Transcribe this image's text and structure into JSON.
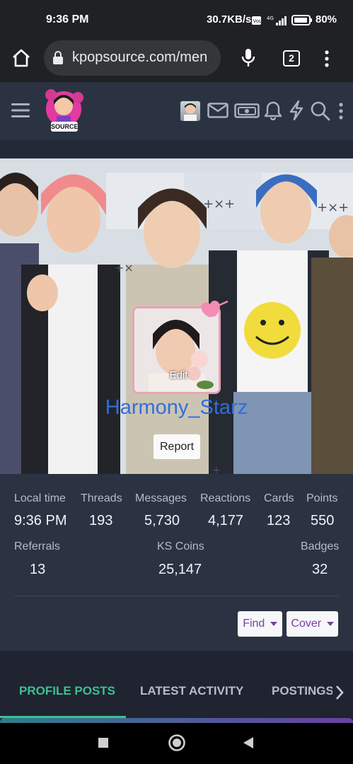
{
  "status_bar": {
    "time": "9:36 PM",
    "network_speed": "30.7KB/s",
    "battery": "80%"
  },
  "browser": {
    "url": "kpopsource.com/men",
    "tab_count": "2"
  },
  "site": {
    "logo_text": "SOURCE"
  },
  "profile": {
    "username": "Harmony_Starz",
    "avatar_edit_label": "Edit",
    "report_label": "Report"
  },
  "stats": {
    "local_time": {
      "label": "Local time",
      "value": "9:36 PM"
    },
    "threads": {
      "label": "Threads",
      "value": "193"
    },
    "messages": {
      "label": "Messages",
      "value": "5,730"
    },
    "reactions": {
      "label": "Reactions",
      "value": "4,177"
    },
    "cards": {
      "label": "Cards",
      "value": "123"
    },
    "points": {
      "label": "Points",
      "value": "550"
    },
    "referrals": {
      "label": "Referrals",
      "value": "13"
    },
    "ks_coins": {
      "label": "KS Coins",
      "value": "25,147"
    },
    "badges": {
      "label": "Badges",
      "value": "32"
    }
  },
  "actions": {
    "find_label": "Find",
    "cover_label": "Cover"
  },
  "tabs": [
    {
      "label": "PROFILE POSTS",
      "active": true
    },
    {
      "label": "LATEST ACTIVITY",
      "active": false
    },
    {
      "label": "POSTINGS",
      "active": false
    }
  ],
  "colors": {
    "accent_green": "#3fbf8f",
    "username_blue": "#2f6fdc",
    "link_purple": "#7a3fa4",
    "panel_bg": "#2b3343"
  }
}
